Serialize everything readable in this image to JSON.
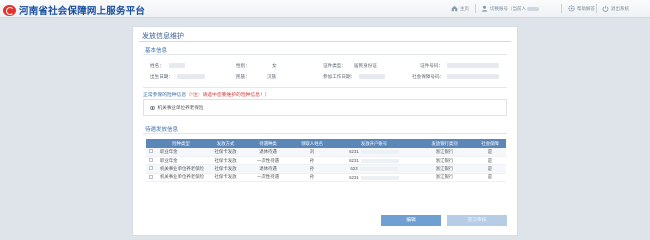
{
  "header": {
    "brand": "河南省社会保障网上服务平台",
    "nav": {
      "home": "主页",
      "account": "切换账号（当前人",
      "help": "帮助解答",
      "exit": "退出系统"
    }
  },
  "page": {
    "title": "发放信息维护",
    "basic_section_title": "基本信息",
    "labels": {
      "name": "姓名：",
      "gender": "性别：",
      "id_type": "证件类型：",
      "id_number": "证件号码：",
      "birth_date": "出生日期：",
      "ethnicity": "民族：",
      "work_date": "参加工作日期：",
      "ss_number": "社会保障号码："
    },
    "values": {
      "gender": "女",
      "id_type": "居民身份证",
      "ethnicity": "汉族"
    },
    "insurance_note_prefix": "正常参保的险种信息",
    "insurance_note_red": "（*注：请选中您要维护的险种信息！）",
    "insurance_item": "机关事业单位养老保险",
    "pending_section_title": "待遇发放信息",
    "table": {
      "headers": [
        "",
        "险种类型",
        "发放方式",
        "待遇种类",
        "领取人姓名",
        "发放开户账号",
        "发放银行类别",
        "社会保障"
      ],
      "rows": [
        {
          "type": "职业年金",
          "method": "社保卡发放",
          "kind": "退休待遇",
          "person": "刘",
          "account": "6231",
          "bank": "浙江银行",
          "ss": "是"
        },
        {
          "type": "职业年金",
          "method": "社保卡发放",
          "kind": "一次性待遇",
          "person": "孙",
          "account": "6231",
          "bank": "浙江银行",
          "ss": "是"
        },
        {
          "type": "机关事业单位养老保险",
          "method": "社保卡发放",
          "kind": "退休待遇",
          "person": "孙",
          "account": "623",
          "bank": "浙江银行",
          "ss": "是"
        },
        {
          "type": "机关事业单位养老保险",
          "method": "社保卡发放",
          "kind": "一次性待遇",
          "person": "孙",
          "account": "6231",
          "bank": "浙江银行",
          "ss": "是"
        }
      ]
    },
    "buttons": {
      "edit": "编辑",
      "submit": "提交审核"
    }
  },
  "colors": {
    "brand_blue": "#1a4e9e",
    "table_header": "#5b86b8",
    "button_primary": "#6f9fd3",
    "button_disabled": "#b7cde5",
    "warning_red": "#d63a3a"
  }
}
